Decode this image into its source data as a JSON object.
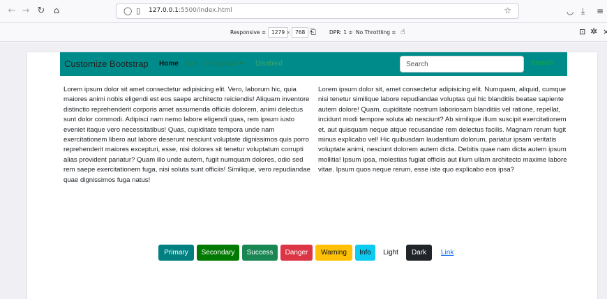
{
  "browser": {
    "url_host": "127.0.0.1",
    "url_rest": ":5500/index.html"
  },
  "responsive": {
    "mode": "Responsive ≑",
    "width": "1279",
    "times": "×",
    "height": "768",
    "dpr": "DPR: 1 ≑",
    "throttle": "No Throttling ≑"
  },
  "navbar": {
    "brand": "Customize Bootstrap",
    "links": [
      {
        "label": "Home",
        "color": "#111111"
      },
      {
        "label": "Link",
        "color": "#1a7f4b"
      },
      {
        "label": "Dropdown ▾",
        "color": "#1a7f4b"
      },
      {
        "label": "Disabled",
        "color": "#3aa86b"
      }
    ],
    "search_placeholder": "Search",
    "search_button": "Search",
    "bg_color": "#008b8b"
  },
  "content": {
    "left_paragraph": "Lorem ipsum dolor sit amet consectetur adipisicing elit. Vero, laborum hic, quia maiores animi nobis eligendi est eos saepe architecto reiciendis! Aliquam inventore distinctio reprehenderit corporis amet assumenda officiis dolorem, animi delectus sunt dolor commodi. Adipisci nam nemo labore eligendi quas, rem ipsum iusto eveniet itaque vero necessitatibus! Quas, cupiditate tempora unde nam exercitationem libero aut labore deserunt nesciunt voluptate dignissimos quis porro reprehenderit maiores excepturi, esse, nisi dolores sit tenetur voluptatum corrupti alias provident pariatur? Quam illo unde autem, fugit numquam dolores, odio sed rem saepe exercitationem fuga, nisi soluta sunt officiis! Similique, vero repudiandae quae dignissimos fuga natus!",
    "right_paragraph": "Lorem ipsum dolor sit, amet consectetur adipisicing elit. Numquam, aliquid, cumque nisi tenetur similique labore repudiandae voluptas qui hic blanditiis beatae sapiente autem dolore! Quam, cupiditate nostrum laboriosam blanditiis vel ratione, repellat, incidunt modi tempore soluta ab nesciunt? Ab similique illum suscipit exercitationem et, aut quisquam neque atque recusandae rem delectus facilis. Magnam rerum fugit minus explicabo vel! Hic quibusdam laudantium dolorum, pariatur ipsam veritatis voluptate animi, nesciunt dolorem autem dicta. Debitis quae nam dicta autem ipsum mollitia! Ipsum ipsa, molestias fugiat officiis aut illum ullam architecto maxime labore vitae. Ipsum quos neque rerum, esse iste quo explicabo eos ipsa?"
  },
  "buttons": [
    {
      "label": "Primary",
      "color": "#008080",
      "text_color": "#ffffff"
    },
    {
      "label": "Secondary",
      "color": "#007a00",
      "text_color": "#ffffff"
    },
    {
      "label": "Success",
      "color": "#198754",
      "text_color": "#ffffff"
    },
    {
      "label": "Danger",
      "color": "#dc3545",
      "text_color": "#ffffff"
    },
    {
      "label": "Warning",
      "color": "#ffc107",
      "text_color": "#111111"
    },
    {
      "label": "Info",
      "color": "#0dcaf0",
      "text_color": "#111111"
    },
    {
      "label": "Light",
      "color": "#ffffff",
      "text_color": "#111111"
    },
    {
      "label": "Dark",
      "color": "#212529",
      "text_color": "#ffffff"
    },
    {
      "label": "Link",
      "color": "transparent",
      "text_color": "#0d6efd"
    }
  ]
}
